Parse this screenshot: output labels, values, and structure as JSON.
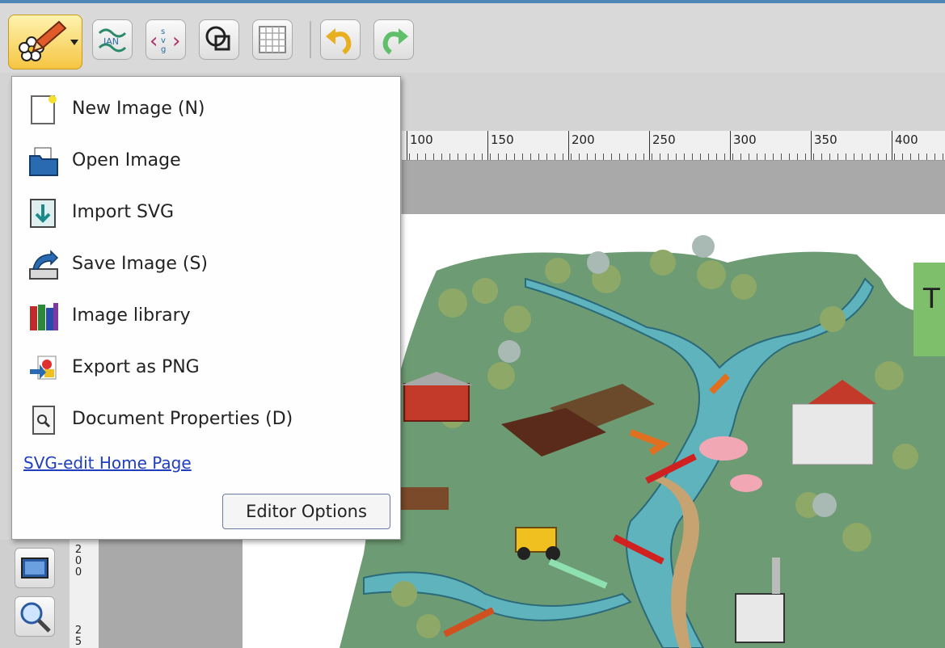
{
  "colors": {
    "accent": "#4f86b8",
    "menu_bg": "#fefefe",
    "link": "#1f3fbf",
    "land": "#6d9b73",
    "river": "#5fb3bd"
  },
  "toolbar": {
    "buttons": [
      {
        "name": "main-menu-button",
        "icon": "pencil-flower-icon"
      },
      {
        "name": "image-library-button",
        "icon": "ian-logo-icon"
      },
      {
        "name": "source-button",
        "icon": "svg-source-icon"
      },
      {
        "name": "wireframe-button",
        "icon": "wireframe-icon"
      },
      {
        "name": "grid-button",
        "icon": "grid-icon"
      },
      {
        "name": "undo-button",
        "icon": "undo-icon"
      },
      {
        "name": "redo-button",
        "icon": "redo-icon"
      }
    ]
  },
  "menu": {
    "items": [
      {
        "label": "New Image (N)",
        "icon": "new-image-icon"
      },
      {
        "label": "Open Image",
        "icon": "folder-open-icon"
      },
      {
        "label": "Import SVG",
        "icon": "import-icon"
      },
      {
        "label": "Save Image (S)",
        "icon": "save-icon"
      },
      {
        "label": "Image library",
        "icon": "books-icon"
      },
      {
        "label": "Export as PNG",
        "icon": "export-icon"
      },
      {
        "label": "Document Properties (D)",
        "icon": "document-properties-icon"
      }
    ],
    "home_link": "SVG-edit Home Page",
    "editor_options": "Editor Options"
  },
  "ruler_h": {
    "labels": [
      "100",
      "150",
      "200",
      "250",
      "300",
      "350",
      "400"
    ]
  },
  "ruler_v": {
    "labels": [
      "2",
      "0",
      "0",
      "2",
      "5"
    ]
  },
  "canvas": {
    "partial_text": "T"
  }
}
